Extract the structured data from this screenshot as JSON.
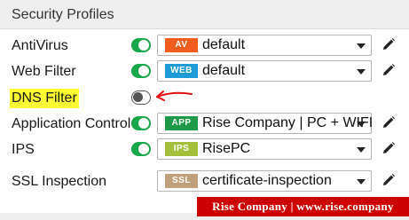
{
  "section": {
    "title": "Security Profiles"
  },
  "profiles": [
    {
      "label": "AntiVirus",
      "enabled": true,
      "badge": "AV",
      "badge_color": "#f25c1f",
      "value": "default"
    },
    {
      "label": "Web Filter",
      "enabled": true,
      "badge": "WEB",
      "badge_color": "#1c9bd6",
      "value": "default"
    },
    {
      "label": "DNS Filter",
      "enabled": false
    },
    {
      "label": "Application Control",
      "enabled": true,
      "badge": "APP",
      "badge_color": "#1f9a48",
      "value": "Rise Company | PC + WIFI"
    },
    {
      "label": "IPS",
      "enabled": true,
      "badge": "IPS",
      "badge_color": "#a4bf3c",
      "value": "RisePC"
    },
    {
      "label": "SSL Inspection",
      "enabled": true,
      "badge": "SSL",
      "badge_color": "#bfa07a",
      "value": "certificate-inspection"
    }
  ],
  "watermark": "Rise Company | www.rise.company",
  "colors": {
    "toggle_on": "#1aa64a",
    "highlight": "#ffff33",
    "annotation_arrow": "#e01010"
  }
}
